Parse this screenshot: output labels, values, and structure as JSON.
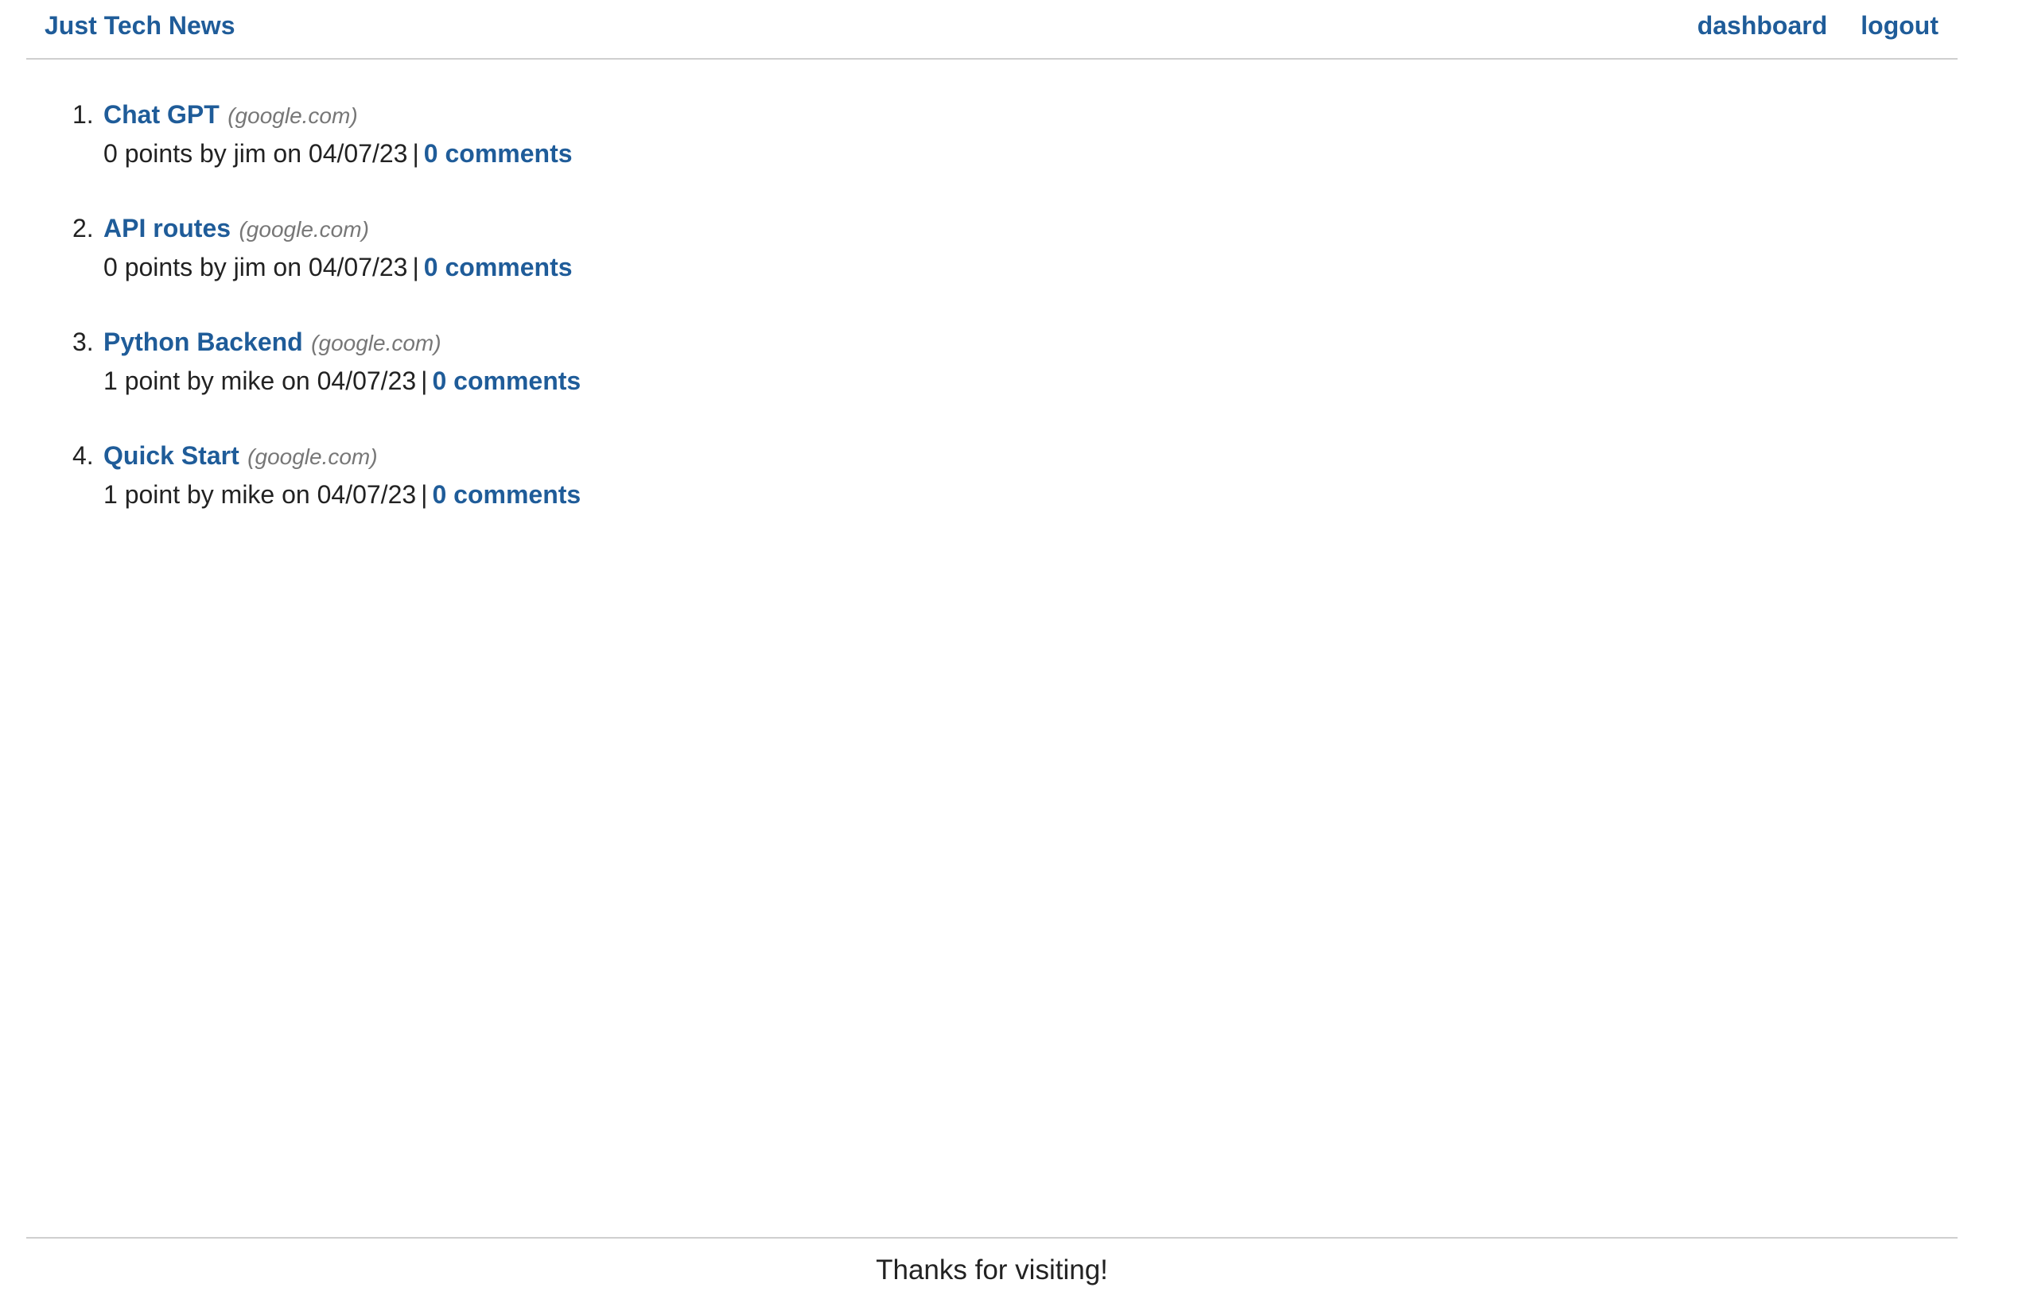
{
  "header": {
    "brand": "Just Tech News",
    "nav": {
      "dashboard": "dashboard",
      "logout": "logout"
    }
  },
  "posts": [
    {
      "num": "1.",
      "title": "Chat GPT",
      "domain": "(google.com)",
      "meta": "0 points by jim on 04/07/23",
      "sep": "|",
      "comments": "0 comments"
    },
    {
      "num": "2.",
      "title": "API routes",
      "domain": "(google.com)",
      "meta": "0 points by jim on 04/07/23",
      "sep": "|",
      "comments": "0 comments"
    },
    {
      "num": "3.",
      "title": "Python Backend",
      "domain": "(google.com)",
      "meta": "1 point by mike on 04/07/23",
      "sep": "|",
      "comments": "0 comments"
    },
    {
      "num": "4.",
      "title": "Quick Start",
      "domain": "(google.com)",
      "meta": "1 point by mike on 04/07/23",
      "sep": "|",
      "comments": "0 comments"
    }
  ],
  "footer": {
    "text": "Thanks for visiting!"
  },
  "colors": {
    "link": "#1f5c99",
    "text": "#222222",
    "domain": "#777777",
    "divider": "#cfcfcf"
  }
}
